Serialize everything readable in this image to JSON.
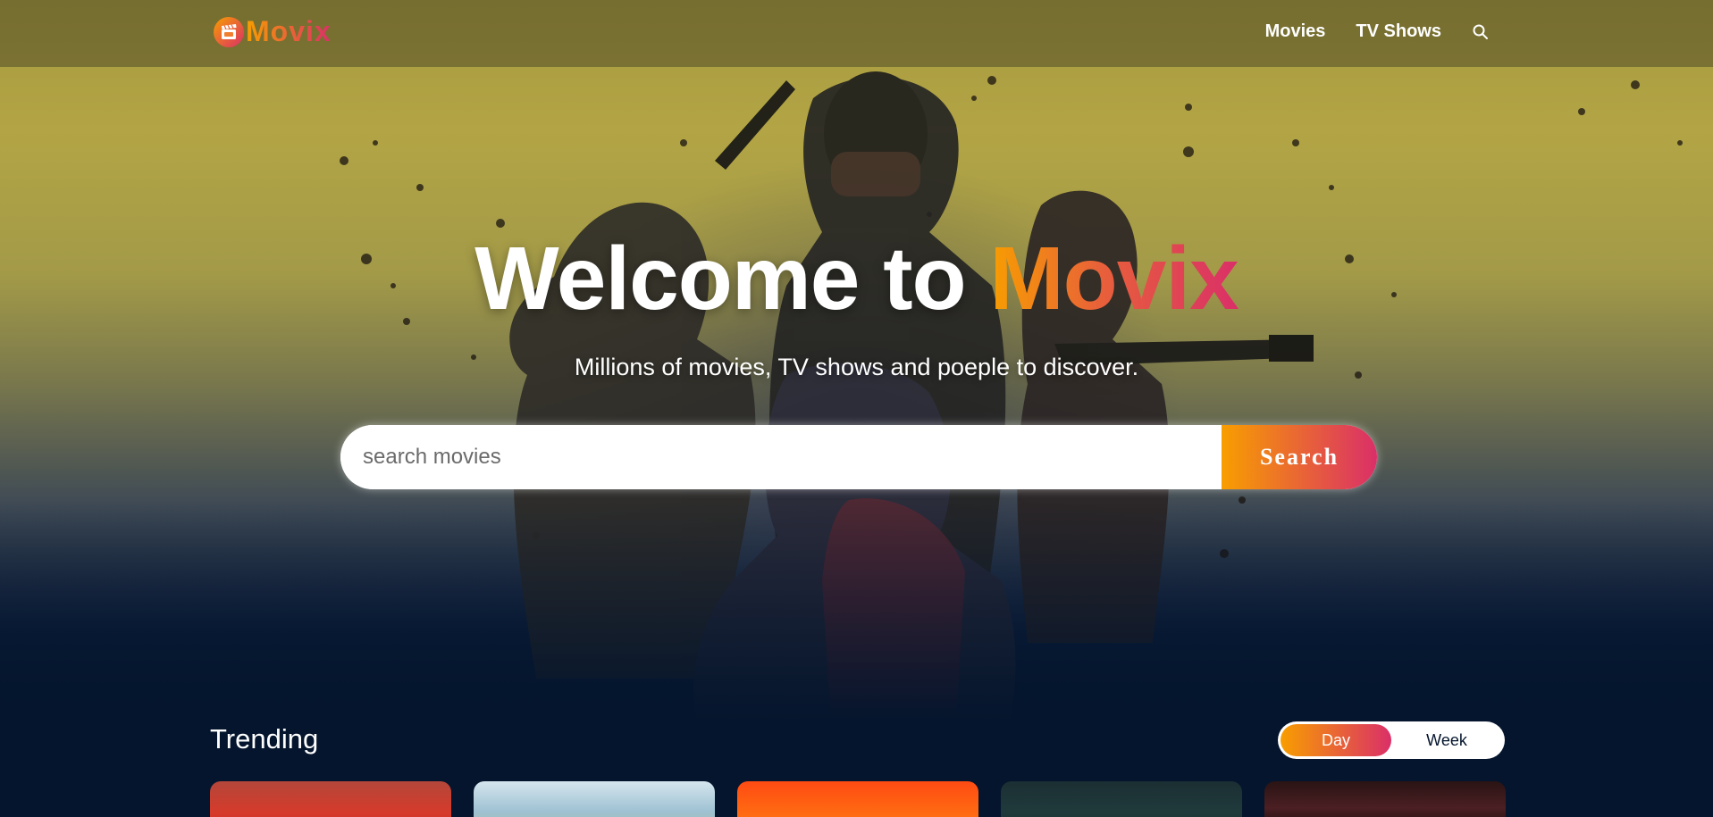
{
  "header": {
    "logo_text": "Movix",
    "nav": [
      {
        "label": "Movies"
      },
      {
        "label": "TV Shows"
      }
    ]
  },
  "hero": {
    "title_prefix": "Welcome to ",
    "title_brand": "Movix",
    "subtitle": "Millions of movies, TV shows and poeple to discover.",
    "search": {
      "placeholder": "search movies",
      "value": "",
      "button_label": "Search"
    }
  },
  "trending": {
    "title": "Trending",
    "tabs": [
      {
        "label": "Day",
        "active": true
      },
      {
        "label": "Week",
        "active": false
      }
    ]
  },
  "colors": {
    "brand_orange": "#f89e00",
    "brand_pink": "#da2f68",
    "background": "#04152d"
  },
  "icons": {
    "logo": "movie-clapper-icon",
    "search": "search-icon"
  }
}
